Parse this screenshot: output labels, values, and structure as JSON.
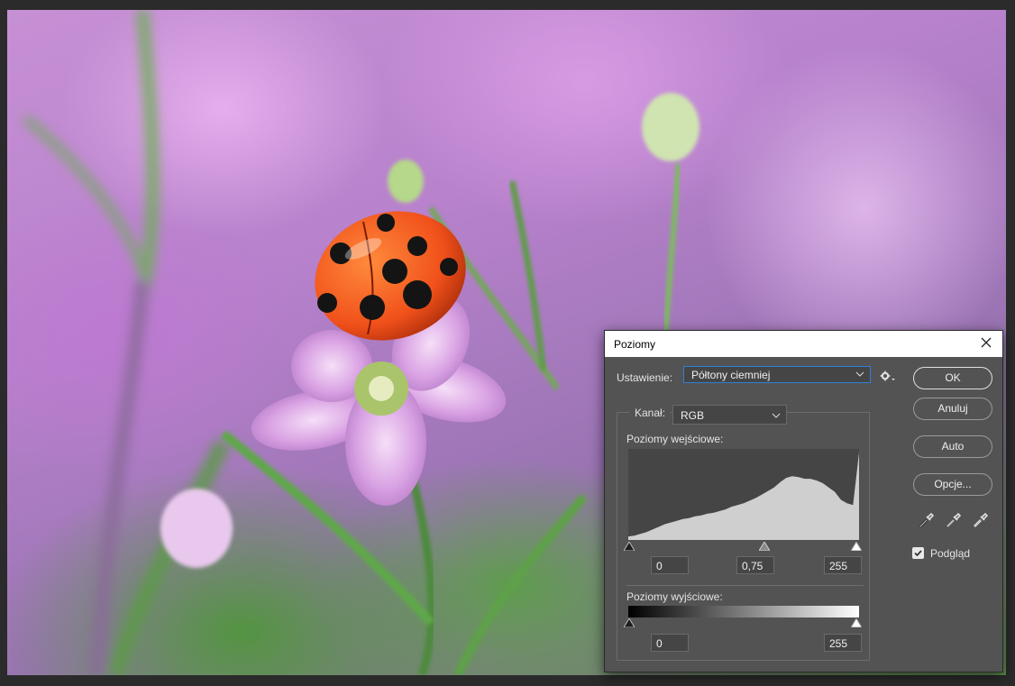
{
  "dialog": {
    "title": "Poziomy",
    "close_icon": "close-icon",
    "preset_label": "Ustawienie:",
    "preset_value": "Półtony ciemniej",
    "channel_label": "Kanał:",
    "channel_value": "RGB",
    "input_levels_label": "Poziomy wejściowe:",
    "input_values": {
      "black": "0",
      "gamma": "0,75",
      "white": "255"
    },
    "output_levels_label": "Poziomy wyjściowe:",
    "output_values": {
      "black": "0",
      "white": "255"
    },
    "buttons": {
      "ok": "OK",
      "cancel": "Anuluj",
      "auto": "Auto",
      "options": "Opcje..."
    },
    "preview_label": "Podgląd",
    "preview_checked": true,
    "eyedroppers": [
      "black-eyedropper-icon",
      "gray-eyedropper-icon",
      "white-eyedropper-icon"
    ]
  },
  "histogram": {
    "description_units": "relative frequency 0-1 across 0-255 levels",
    "values": [
      0.04,
      0.05,
      0.07,
      0.09,
      0.12,
      0.15,
      0.18,
      0.2,
      0.22,
      0.24,
      0.25,
      0.27,
      0.28,
      0.3,
      0.31,
      0.33,
      0.35,
      0.38,
      0.4,
      0.42,
      0.45,
      0.48,
      0.52,
      0.56,
      0.6,
      0.66,
      0.71,
      0.73,
      0.72,
      0.7,
      0.7,
      0.68,
      0.65,
      0.6,
      0.55,
      0.46,
      0.42,
      0.4,
      1.0
    ],
    "colors": {
      "background": "#454545",
      "fill": "#cfcfcf"
    }
  },
  "colors": {
    "dialog_bg": "#535353",
    "accent_focus": "#2f7fd8"
  }
}
